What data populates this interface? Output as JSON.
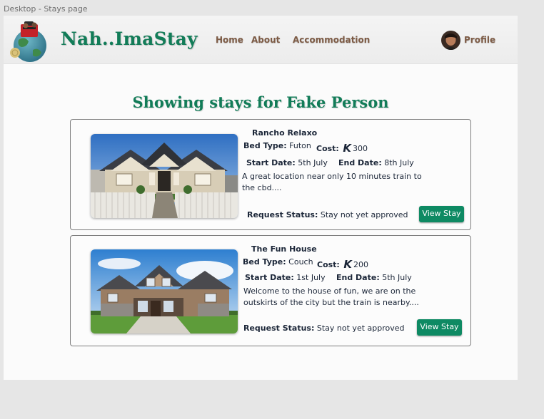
{
  "frame": {
    "label": "Desktop - Stays page"
  },
  "header": {
    "brand": "Nah..ImaStay",
    "nav": {
      "home": "Home",
      "about": "About",
      "accommodation": "Accommodation"
    },
    "profile": "Profile"
  },
  "main": {
    "heading": "Showing stays for Fake Person",
    "labels": {
      "bed_type": "Bed Type:",
      "cost": "Cost:",
      "start_date": "Start Date:",
      "end_date": "End Date:",
      "request_status": "Request Status:",
      "view_stay": "View Stay"
    },
    "stays": [
      {
        "title": "Rancho Relaxo",
        "bed_type": "Futon",
        "cost": "300",
        "start_date": "5th July",
        "end_date": "8th July",
        "description": "A great location near only 10 minutes train to the cbd....",
        "request_status": "Stay not yet approved"
      },
      {
        "title": "The Fun House",
        "bed_type": "Couch",
        "cost": "200",
        "start_date": "1st July",
        "end_date": "5th July",
        "description": "Welcome to the house of fun, we are on the outskirts of the city but the train is nearby....",
        "request_status": "Stay not yet approved"
      }
    ]
  },
  "colors": {
    "brand_green": "#127c58",
    "nav_brown": "#7d5b45",
    "button_green": "#0e8a63"
  },
  "icons": {
    "currency": "K-currency-icon",
    "logo": "globe-with-luggage-logo"
  }
}
